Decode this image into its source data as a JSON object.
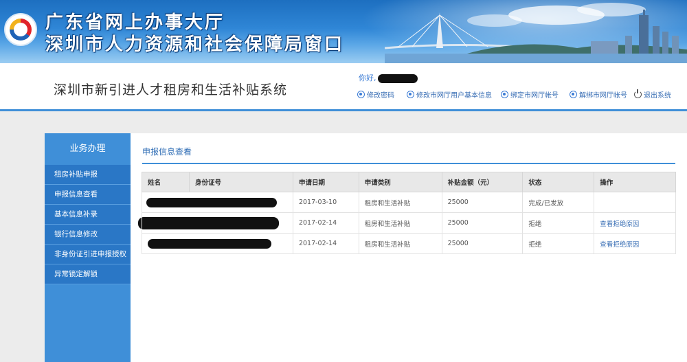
{
  "banner": {
    "line1": "广东省网上办事大厅",
    "line2": "深圳市人力资源和社会保障局窗口"
  },
  "header": {
    "system_title": "深圳市新引进人才租房和生活补贴系统",
    "greeting": "你好,",
    "links": [
      {
        "label": "修改密码",
        "icon": "gear-icon"
      },
      {
        "label": "修改市网厅用户基本信息",
        "icon": "gear-icon"
      },
      {
        "label": "绑定市网厅帐号",
        "icon": "gear-icon"
      },
      {
        "label": "解绑市网厅帐号",
        "icon": "gear-icon"
      },
      {
        "label": "退出系统",
        "icon": "power-icon"
      }
    ]
  },
  "sidebar": {
    "title": "业务办理",
    "items": [
      {
        "label": "租房补贴申报"
      },
      {
        "label": "申报信息查看"
      },
      {
        "label": "基本信息补录"
      },
      {
        "label": "银行信息修改"
      },
      {
        "label": "非身份证引进申报授权"
      },
      {
        "label": "异常锁定解锁"
      }
    ]
  },
  "main": {
    "panel_title": "申报信息查看",
    "table": {
      "headers": [
        "姓名",
        "身份证号",
        "申请日期",
        "申请类别",
        "补贴金额（元）",
        "状态",
        "操作"
      ],
      "rows": [
        {
          "date": "2017-03-10",
          "category": "租房和生活补贴",
          "amount": "25000",
          "status": "完成/已发放",
          "action": ""
        },
        {
          "date": "2017-02-14",
          "category": "租房和生活补贴",
          "amount": "25000",
          "status": "拒绝",
          "action": "查看拒绝原因"
        },
        {
          "date": "2017-02-14",
          "category": "租房和生活补贴",
          "amount": "25000",
          "status": "拒绝",
          "action": "查看拒绝原因"
        }
      ]
    }
  },
  "colors": {
    "accent": "#3f8fd8",
    "sidebar_item": "#2a77c6",
    "link": "#3a6fb5"
  }
}
